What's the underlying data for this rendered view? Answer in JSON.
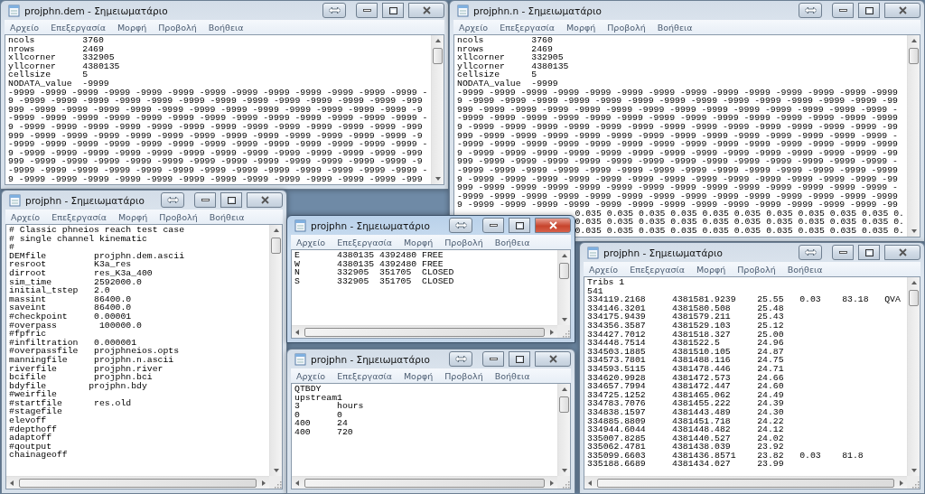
{
  "windows": [
    {
      "title": "projphn.dem - Σημειωματάριο",
      "active": false,
      "horizontal_scrollbar": false,
      "menu": [
        "Αρχείο",
        "Επεξεργασία",
        "Μορφή",
        "Προβολή",
        "Βοήθεια"
      ],
      "lines": [
        "ncols         3760",
        "nrows         2469",
        "xllcorner     332905",
        "yllcorner     4380135",
        "cellsize      5",
        "NODATA_value  -9999",
        "-9999 -9999 -9999 -9999 -9999 -9999 -9999 -9999 -9999 -9999 -9999 -9999 -9999 -",
        "9 -9999 -9999 -9999 -9999 -9999 -9999 -9999 -9999 -9999 -9999 -9999 -9999 -999",
        "999 -9999 -9999 -9999 -9999 -9999 -9999 -9999 -9999 -9999 -9999 -9999 -9999 -9",
        "-9999 -9999 -9999 -9999 -9999 -9999 -9999 -9999 -9999 -9999 -9999 -9999 -9999 -",
        "9 -9999 -9999 -9999 -9999 -9999 -9999 -9999 -9999 -9999 -9999 -9999 -9999 -999",
        "999 -9999 -9999 -9999 -9999 -9999 -9999 -9999 -9999 -9999 -9999 -9999 -9999 -9",
        "-9999 -9999 -9999 -9999 -9999 -9999 -9999 -9999 -9999 -9999 -9999 -9999 -9999 -",
        "9 -9999 -9999 -9999 -9999 -9999 -9999 -9999 -9999 -9999 -9999 -9999 -9999 -999",
        "999 -9999 -9999 -9999 -9999 -9999 -9999 -9999 -9999 -9999 -9999 -9999 -9999 -9",
        "-9999 -9999 -9999 -9999 -9999 -9999 -9999 -9999 -9999 -9999 -9999 -9999 -9999 -",
        "9 -9999 -9999 -9999 -9999 -9999 -9999 -9999 -9999 -9999 -9999 -9999 -9999 -999"
      ]
    },
    {
      "title": "projphn.n - Σημειωματάριο",
      "active": false,
      "horizontal_scrollbar": false,
      "menu": [
        "Αρχείο",
        "Επεξεργασία",
        "Μορφή",
        "Προβολή",
        "Βοήθεια"
      ],
      "lines": [
        "ncols         3760",
        "nrows         2469",
        "xllcorner     332905",
        "yllcorner     4380135",
        "cellsize      5",
        "NODATA_value  -9999",
        "-9999 -9999 -9999 -9999 -9999 -9999 -9999 -9999 -9999 -9999 -9999 -9999 -9999 -9999",
        "9 -9999 -9999 -9999 -9999 -9999 -9999 -9999 -9999 -9999 -9999 -9999 -9999 -9999 -99",
        "999 -9999 -9999 -9999 -9999 -9999 -9999 -9999 -9999 -9999 -9999 -9999 -9999 -9999 -",
        "-9999 -9999 -9999 -9999 -9999 -9999 -9999 -9999 -9999 -9999 -9999 -9999 -9999 -9999",
        "9 -9999 -9999 -9999 -9999 -9999 -9999 -9999 -9999 -9999 -9999 -9999 -9999 -9999 -99",
        "999 -9999 -9999 -9999 -9999 -9999 -9999 -9999 -9999 -9999 -9999 -9999 -9999 -9999 -",
        "-9999 -9999 -9999 -9999 -9999 -9999 -9999 -9999 -9999 -9999 -9999 -9999 -9999 -9999",
        "9 -9999 -9999 -9999 -9999 -9999 -9999 -9999 -9999 -9999 -9999 -9999 -9999 -9999 -99",
        "999 -9999 -9999 -9999 -9999 -9999 -9999 -9999 -9999 -9999 -9999 -9999 -9999 -9999 -",
        "-9999 -9999 -9999 -9999 -9999 -9999 -9999 -9999 -9999 -9999 -9999 -9999 -9999 -9999",
        "9 -9999 -9999 -9999 -9999 -9999 -9999 -9999 -9999 -9999 -9999 -9999 -9999 -9999 -99",
        "999 -9999 -9999 -9999 -9999 -9999 -9999 -9999 -9999 -9999 -9999 -9999 -9999 -9999 -",
        "-9999 -9999 -9999 -9999 -9999 -9999 -9999 -9999 -9999 -9999 -9999 -9999 -9999 -9999",
        "9 -9999 -9999 -9999 -9999 -9999 -9999 -9999 -9999 -9999 -9999 -9999 -9999 -9999 -99",
        {
          "kind": "cut_left",
          "text": "0.035 0.035 0.035 0.035 0.035 0.035 0.035 0.035 0.035 0.035 0."
        },
        {
          "kind": "cut_left",
          "text": "0.035 0.035 0.035 0.035 0.035 0.035 0.035 0.035 0.035 0.035 0."
        },
        {
          "kind": "cut_left",
          "text": "0.035 0.035 0.035 0.035 0.035 0.035 0.035 0.035 0.035 0.035 0."
        }
      ]
    },
    {
      "title": "projphn - Σημειωματάριο",
      "active": false,
      "horizontal_scrollbar": true,
      "menu": [
        "Αρχείο",
        "Επεξεργασία",
        "Μορφή",
        "Προβολή",
        "Βοήθεια"
      ],
      "lines": [
        "# Classic phneios reach test case",
        "# single channel kinematic",
        "#",
        "DEMfile         projphn.dem.ascii",
        "resroot         K3a_res",
        "dirroot         res_K3a_400",
        "sim_time        2592000.0",
        "initial_tstep   2.0",
        "massint         86400.0",
        "saveint         86400.0",
        "#checkpoint     0.00001",
        "#overpass        100000.0",
        "#fpfric",
        "#infiltration   0.000001",
        "#overpassfile   projphneios.opts",
        "manningfile     projphn.n.ascii",
        "riverfile       projphn.river",
        "bcifile         projphn.bci",
        "bdyfile        projphn.bdy",
        "#weirfile",
        "#startfile      res.old",
        "#stagefile",
        "elevoff",
        "#depthoff",
        "adaptoff",
        "#qoutput",
        "chainageoff"
      ]
    },
    {
      "title": "projphn - Σημειωματάριο",
      "active": false,
      "horizontal_scrollbar": true,
      "menu": [
        "Αρχείο",
        "Επεξεργασία",
        "Μορφή",
        "Προβολή",
        "Βοήθεια"
      ],
      "lines": [
        "Tribs 1",
        "541",
        "334119.2168     4381581.9239    25.55   0.03    83.18   QVA",
        "334146.3201     4381580.508     25.48",
        "334175.9439     4381579.211     25.43",
        "334356.3587     4381529.103     25.12",
        "334427.7012     4381518.327     25.00",
        "334448.7514     4381522.5       24.96",
        "334503.1885     4381510.105     24.87",
        "334573.7801     4381488.116     24.75",
        "334593.5115     4381478.446     24.71",
        "334620.9928     4381472.573     24.66",
        "334657.7994     4381472.447     24.60",
        "334725.1252     4381465.062     24.49",
        "334783.7076     4381455.222     24.39",
        "334838.1597     4381443.489     24.30",
        "334885.8809     4381451.718     24.22",
        "334944.6044     4381448.482     24.12",
        "335007.8285     4381440.527     24.02",
        "335062.4781     4381438.039     23.92",
        "335099.6603     4381436.8571    23.82   0.03    81.8",
        "335188.6689     4381434.027     23.99"
      ]
    },
    {
      "title": "projphn - Σημειωματάριο",
      "active": true,
      "horizontal_scrollbar": true,
      "menu": [
        "Αρχείο",
        "Επεξεργασία",
        "Μορφή",
        "Προβολή",
        "Βοήθεια"
      ],
      "lines": [
        "E       4380135 4392480 FREE",
        "W       4380135 4392480 FREE",
        "N       332905  351705  CLOSED",
        "S       332905  351705  CLOSED"
      ]
    },
    {
      "title": "projphn - Σημειωματάριο",
      "active": false,
      "horizontal_scrollbar": true,
      "menu": [
        "Αρχείο",
        "Επεξεργασία",
        "Μορφή",
        "Προβολή",
        "Βοήθεια"
      ],
      "lines": [
        "QTBDY",
        "upstream1",
        "3       hours",
        "0       0",
        "400     24",
        "400     720"
      ]
    }
  ]
}
